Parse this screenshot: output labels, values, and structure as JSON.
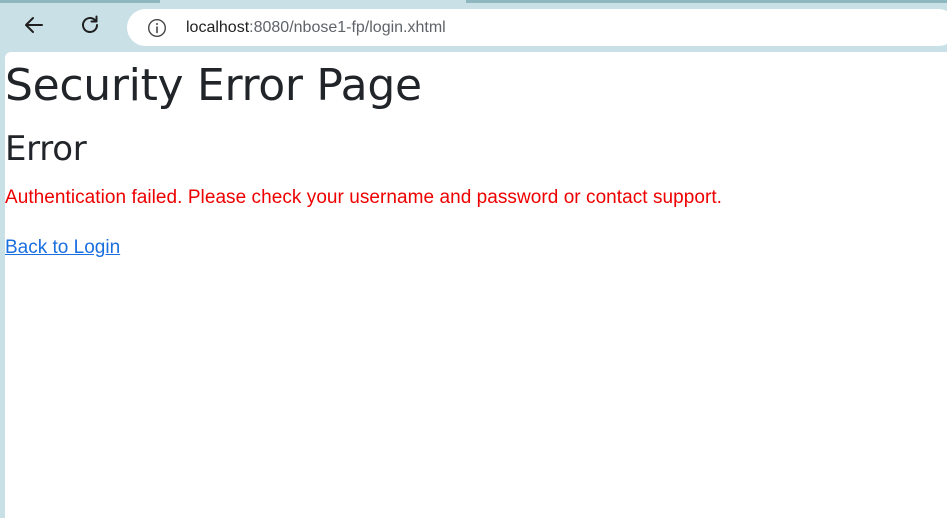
{
  "browser": {
    "url_host": "localhost",
    "url_path": ":8080/nbose1-fp/login.xhtml",
    "icons": {
      "back": "arrow-left-icon",
      "reload": "reload-icon",
      "site_info": "info-icon"
    }
  },
  "page": {
    "title": "Security Error Page",
    "heading": "Error",
    "message": "Authentication failed. Please check your username and password or contact support.",
    "back_link": "Back to Login"
  },
  "colors": {
    "error_text": "#ee0000",
    "link": "#1a6fe0",
    "chrome_bg": "#c9e1e6"
  }
}
